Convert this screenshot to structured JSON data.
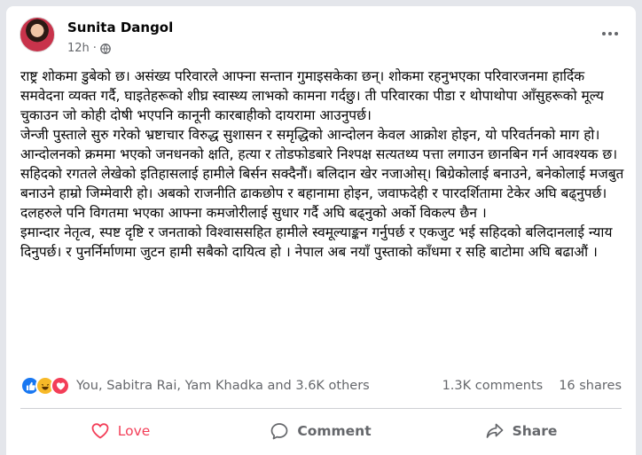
{
  "post": {
    "author": "Sunita Dangol",
    "time": "12h",
    "separator": "·",
    "body": [
      "राष्ट्र शोकमा डुबेको छ। असंख्य परिवारले आफ्ना सन्तान गुमाइसकेका छन्। शोकमा रहनुभएका परिवारजनमा हार्दिक समवेदना व्यक्त गर्दै, घाइतेहरूको शीघ्र स्वास्थ्य लाभको कामना गर्दछु। ती परिवारका पीडा र थोपाथोपा आँसुहरूको मूल्य चुकाउन जो कोही दोषी भएपनि कानूनी कारबाहीको दायरामा आउनुपर्छ।",
      "जेन्जी पुस्ताले सुरु गरेको भ्रष्टाचार विरुद्ध सुशासन र समृद्धिको आन्दोलन केवल आक्रोश होइन, यो परिवर्तनको माग हो। आन्दोलनको क्रममा भएको जनधनको क्षति, हत्या र तोडफोडबारे निश्पक्ष सत्यतथ्य पत्ता लगाउन छानबिन गर्न आवश्यक छ।",
      "सहिदको रगतले लेखेको इतिहासलाई हामीले बिर्सन सक्दैनौं। बलिदान खेर नजाओस्। बिग्रेकोलाई बनाउने, बनेकोलाई मजबुत बनाउने हाम्रो जिम्मेवारी हो। अबको राजनीति ढाकछोप र बहानामा होइन, जवाफदेही र पारदर्शितामा टेकेर अघि बढ्नुपर्छ। दलहरुले पनि विगतमा भएका आफ्ना कमजोरीलाई सुधार गर्दै अघि बढ्नुको अर्को विकल्प छैन ।",
      "इमान्दार नेतृत्व, स्पष्ट दृष्टि र जनताको विश्वाससहित हामीले स्वमूल्याङ्कन गर्नुपर्छ र एकजुट भई सहिदको बलिदानलाई न्याय दिनुपर्छ। र पुनर्निर्माणमा जुटन हामी सबैको दायित्व हो । नेपाल अब नयाँ पुस्ताको काँधमा र सहि बाटोमा अघि बढाऔं ।"
    ]
  },
  "stats": {
    "reactors": "You, Sabitra Rai, Yam Khadka and 3.6K others",
    "comments": "1.3K comments",
    "shares": "16 shares"
  },
  "actions": {
    "love": "Love",
    "comment": "Comment",
    "share": "Share"
  },
  "colors": {
    "love_active": "#f33e58",
    "like_blue": "#1877f2",
    "haha_yellow": "#f7b928",
    "secondary_text": "#65676b"
  },
  "icons": {
    "privacy": "globe-icon",
    "more": "more-options-icon",
    "reactions": [
      "like-reaction-icon",
      "haha-reaction-icon",
      "love-reaction-icon"
    ],
    "love_action": "heart-icon",
    "comment_action": "comment-bubble-icon",
    "share_action": "share-arrow-icon"
  }
}
